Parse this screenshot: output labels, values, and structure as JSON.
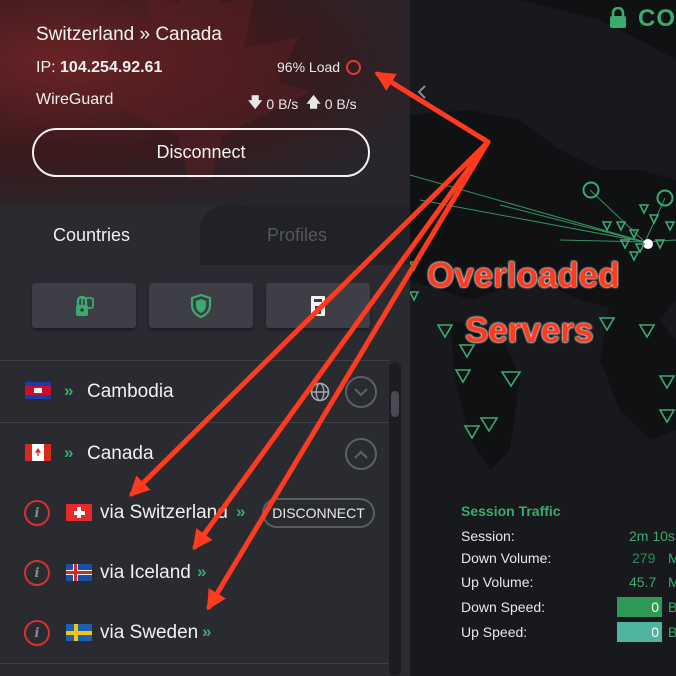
{
  "connection": {
    "route": "Switzerland » Canada",
    "ip_label": "IP:",
    "ip": "104.254.92.61",
    "load": "96% Load",
    "protocol": "WireGuard",
    "down_rate": "0 B/s",
    "up_rate": "0 B/s",
    "disconnect_label": "Disconnect",
    "status_text": "CO"
  },
  "tabs": [
    {
      "label": "Countries",
      "active": true
    },
    {
      "label": "Profiles",
      "active": false
    }
  ],
  "quick_buttons": [
    {
      "icon": "secure-core-lock-icon"
    },
    {
      "icon": "netshield-icon"
    },
    {
      "icon": "kill-switch-icon"
    }
  ],
  "list": {
    "countries": [
      {
        "name": "Cambodia",
        "flag": "cambodia-flag-icon"
      },
      {
        "name": "Canada",
        "flag": "canada-flag-icon"
      }
    ],
    "servers": [
      {
        "name": "via Switzerland",
        "flag": "switzerland-flag-icon",
        "action": "DISCONNECT"
      },
      {
        "name": "via Iceland",
        "flag": "iceland-flag-icon"
      },
      {
        "name": "via Sweden",
        "flag": "sweden-flag-icon"
      }
    ],
    "chevron": "»"
  },
  "session": {
    "title": "Session Traffic",
    "rows": [
      {
        "label": "Session:",
        "value": "2m 10s"
      },
      {
        "label": "Down Volume:",
        "value": "279",
        "unit": "M"
      },
      {
        "label": "Up Volume:",
        "value": "45.7",
        "unit": "M"
      },
      {
        "label": "Down Speed:",
        "value": "0",
        "unit": "B"
      },
      {
        "label": "Up Speed:",
        "value": "0",
        "unit": "B"
      }
    ]
  },
  "annotation": {
    "line1": "Overloaded",
    "line2": "Servers"
  },
  "colors": {
    "accent_green": "#3aaa6e",
    "alert_red": "#e03a3a",
    "annotation_red": "#ff3b1f"
  }
}
